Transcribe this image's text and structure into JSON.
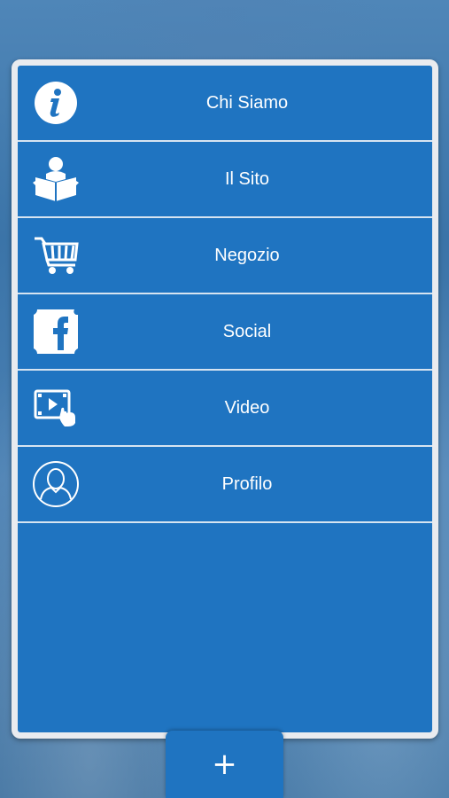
{
  "menu": {
    "items": [
      {
        "label": "Chi Siamo",
        "icon": "info-icon"
      },
      {
        "label": "Il Sito",
        "icon": "reader-icon"
      },
      {
        "label": "Negozio",
        "icon": "cart-icon"
      },
      {
        "label": "Social",
        "icon": "facebook-icon"
      },
      {
        "label": "Video",
        "icon": "video-icon"
      },
      {
        "label": "Profilo",
        "icon": "user-profile-icon"
      }
    ]
  },
  "add_button": {
    "symbol": "+"
  },
  "colors": {
    "panel_blue": "#1f74c1",
    "border": "#e9ebef",
    "divider": "#d6e4f1",
    "text": "#ffffff"
  }
}
